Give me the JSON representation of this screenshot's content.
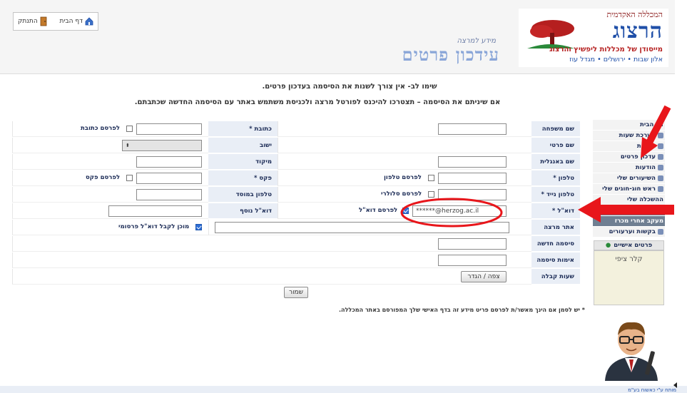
{
  "header": {
    "logo_college": "המכללה האקדמית",
    "logo_name": "הרצוג",
    "logo_tagline": "מייסודן של מכללות ליפשיץ והרצוג",
    "logo_cities": "אלון שבות • ירושלים • מגדל עוז",
    "page_subtitle": "מידע למרצה",
    "page_title": "עידכון פרטים",
    "home_label": "דף הבית",
    "logout_label": "התנתק"
  },
  "notes": {
    "line1": "שימו לב- אין צורך לשנות את הסיסמה בעדכון פרטים.",
    "line2": "אם שיניתם את הסיסמה – תצטרכו להיכנס לפורטל מרצה ולכניסת משתמש באתר עם הסיסמה החדשה שכתבתם."
  },
  "form": {
    "last_name": "שם משפחה",
    "first_name": "שם פרטי",
    "english_name": "שם באנגלית",
    "phone": "טלפון *",
    "publish_phone": "לפרסם טלפון",
    "mobile": "טלפון נייד *",
    "publish_mobile": "לפרסם סלולרי",
    "email": "דוא\"ל *",
    "publish_email": "לפרסם דוא\"ל",
    "email_value": "******@herzog.ac.il",
    "lecturer_site": "אתר מרצה",
    "new_password": "סיסמה חדשה",
    "confirm_password": "אימות סיסמה",
    "office_hours": "שעות קבלה",
    "view_define": "צפה / הגדר",
    "address": "כתובת *",
    "publish_address": "לפרסם כתובת",
    "city": "ישוב",
    "zip": "מיקוד",
    "fax": "פקס *",
    "publish_fax": "לפרסם פקס",
    "institution_phone": "טלפון במוסד",
    "additional_email": "דוא\"ל נוסף",
    "consent_email": "מוכן לקבל דוא\"ל פרסומי",
    "save": "שמור"
  },
  "footnote": "* יש לסמן אם הינך מאשר/ת לפרסם פריט מידע זה בדף האישי שלך המפורסם באתר המכללה.",
  "sidebar": {
    "items": [
      {
        "label": "דף הבית"
      },
      {
        "label": "מערכת שעות"
      },
      {
        "label": "בחינות"
      },
      {
        "label": "עדכון פרטים"
      },
      {
        "label": "הודעות"
      },
      {
        "label": "השיעורים שלי"
      },
      {
        "label": "ראש חוג-חוגים שלי"
      },
      {
        "label": "ההשכלה שלי"
      },
      {
        "label": "אפשרויות ותכנים"
      },
      {
        "label": "מעקב אחרי מכרז"
      },
      {
        "label": "בקשות וערעורים"
      }
    ],
    "personal_header": "פרטים אישיים",
    "personal_name": "קלר ציפי"
  },
  "credit": "מותח ע\"י כאשוח בע\"מ",
  "colors": {
    "accent_red": "#e8161b",
    "label_bg": "#e9eef6",
    "title_blue": "#8aa6d8",
    "checkbox_blue": "#2f6fd6"
  }
}
